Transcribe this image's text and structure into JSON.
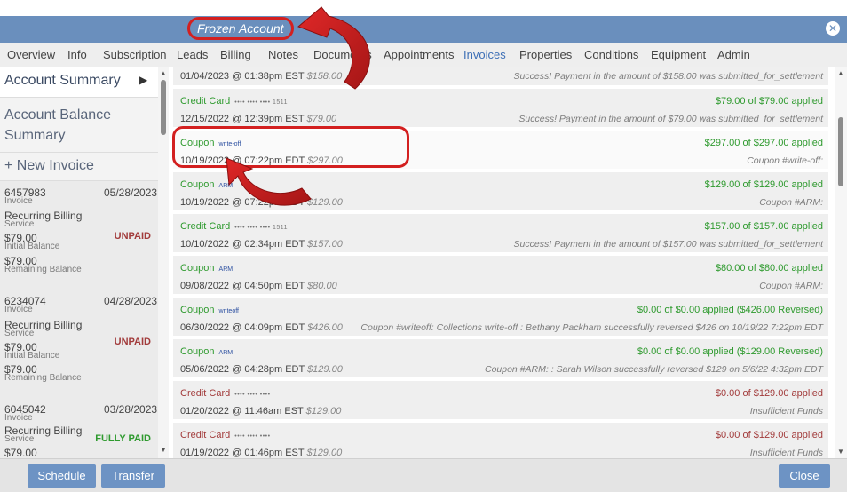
{
  "title": "Frozen Account",
  "colors": {
    "accent": "#6a8fbd",
    "applied_green": "#2e9a2e",
    "unpaid_red": "#a23b3b",
    "annotation_red": "#d32020"
  },
  "nav": {
    "tabs": [
      "Overview",
      "Info",
      "Subscription",
      "Leads",
      "Billing",
      "Notes",
      "Documents",
      "Appointments",
      "Invoices",
      "Properties",
      "Conditions",
      "Equipment",
      "Admin"
    ],
    "active": "Invoices"
  },
  "sidebar": {
    "summary_label": "Account Summary",
    "balance_label": "Account Balance Summary",
    "new_invoice_label": "+ New Invoice",
    "invoices": [
      {
        "number": "6457983",
        "date": "05/28/2023",
        "type": "Invoice",
        "service": "Recurring Billing",
        "service_sub": "Service",
        "status": "UNPAID",
        "initial": "$79.00",
        "initial_label": "Initial Balance",
        "remaining": "$79.00",
        "remaining_label": "Remaining Balance"
      },
      {
        "number": "6234074",
        "date": "04/28/2023",
        "type": "Invoice",
        "service": "Recurring Billing",
        "service_sub": "Service",
        "status": "UNPAID",
        "initial": "$79.00",
        "initial_label": "Initial Balance",
        "remaining": "$79.00",
        "remaining_label": "Remaining Balance"
      },
      {
        "number": "6045042",
        "date": "03/28/2023",
        "type": "Invoice",
        "service": "Recurring Billing",
        "service_sub": "Service",
        "status": "FULLY PAID",
        "initial": "$79.00",
        "initial_label": "",
        "remaining": "",
        "remaining_label": ""
      }
    ]
  },
  "payments": [
    {
      "method": "",
      "sub": "",
      "when": "01/04/2023 @ 01:38pm EST",
      "amount": "$158.00",
      "applied": "",
      "note": "Success! Payment in the amount of $158.00 was submitted_for_settlement"
    },
    {
      "method": "Credit Card",
      "sub": "•••• •••• •••• 1511",
      "when": "12/15/2022 @ 12:39pm EST",
      "amount": "$79.00",
      "applied": "$79.00 of $79.00 applied",
      "note": "Success! Payment in the amount of $79.00 was submitted_for_settlement"
    },
    {
      "method": "Coupon",
      "sub": "write-off",
      "when": "10/19/2022 @ 07:22pm EDT",
      "amount": "$297.00",
      "applied": "$297.00 of $297.00 applied",
      "note": "Coupon #write-off:"
    },
    {
      "method": "Coupon",
      "sub": "ARM",
      "when": "10/19/2022 @ 07:22pm EDT",
      "amount": "$129.00",
      "applied": "$129.00 of $129.00 applied",
      "note": "Coupon #ARM:"
    },
    {
      "method": "Credit Card",
      "sub": "•••• •••• •••• 1511",
      "when": "10/10/2022 @ 02:34pm EDT",
      "amount": "$157.00",
      "applied": "$157.00 of $157.00 applied",
      "note": "Success! Payment in the amount of $157.00 was submitted_for_settlement"
    },
    {
      "method": "Coupon",
      "sub": "ARM",
      "when": "09/08/2022 @ 04:50pm EDT",
      "amount": "$80.00",
      "applied": "$80.00 of $80.00 applied",
      "note": "Coupon #ARM:"
    },
    {
      "method": "Coupon",
      "sub": "writeoff",
      "when": "06/30/2022 @ 04:09pm EDT",
      "amount": "$426.00",
      "applied": "$0.00 of $0.00 applied ($426.00 Reversed)",
      "note": "Coupon #writeoff: Collections write-off : Bethany Packham successfully reversed $426 on 10/19/22 7:22pm EDT"
    },
    {
      "method": "Coupon",
      "sub": "ARM",
      "when": "05/06/2022 @ 04:28pm EDT",
      "amount": "$129.00",
      "applied": "$0.00 of $0.00 applied ($129.00 Reversed)",
      "note": "Coupon #ARM: : Sarah Wilson successfully reversed $129 on 5/6/22 4:32pm EDT"
    },
    {
      "method": "Credit Card",
      "sub": "•••• •••• ••••",
      "when": "01/20/2022 @ 11:46am EST",
      "amount": "$129.00",
      "applied": "$0.00 of $129.00 applied",
      "note": "Insufficient Funds"
    },
    {
      "method": "Credit Card",
      "sub": "•••• •••• ••••",
      "when": "01/19/2022 @ 01:46pm EST",
      "amount": "$129.00",
      "applied": "$0.00 of $129.00 applied",
      "note": "Insufficient Funds"
    }
  ],
  "footer": {
    "schedule": "Schedule",
    "transfer": "Transfer",
    "close": "Close"
  },
  "icons": {
    "close": "close-circle-icon",
    "caret": "caret-right-icon",
    "arrows": "annotation-arrow-icon"
  }
}
